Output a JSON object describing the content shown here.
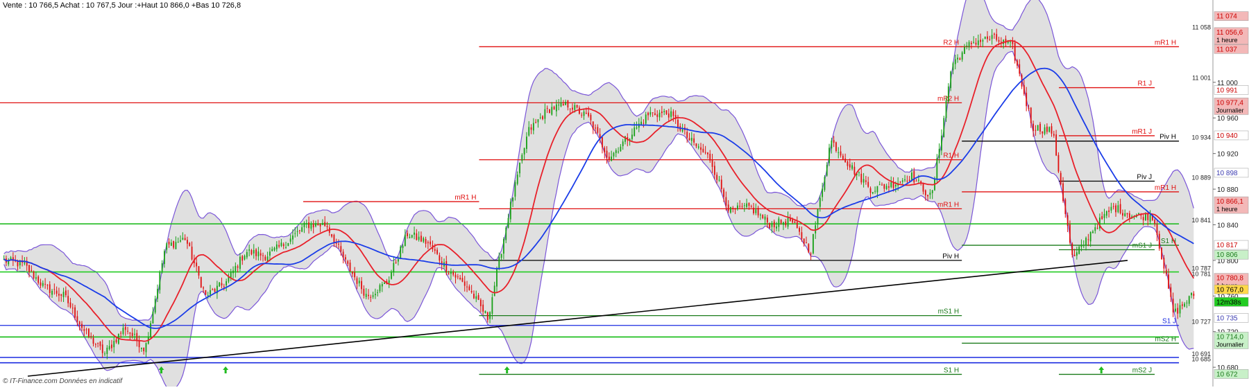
{
  "header": {
    "quote": "Vente : 10 766,5 Achat : 10 767,5 Jour :+Haut 10 866,0 +Bas 10 726,8"
  },
  "footer": {
    "credit": "© IT-Finance.com  Données en indicatif"
  },
  "chart_data": {
    "type": "candlestick",
    "y_range": [
      10670,
      11080
    ],
    "y_ticks": [
      "11 000",
      "10 960",
      "10 920",
      "10 880",
      "10 840",
      "10 800",
      "10 760",
      "10 720",
      "10 680"
    ],
    "grid": false,
    "bollinger_band": "on",
    "moving_averages": [
      "red",
      "blue"
    ],
    "trendline": {
      "from": 10670,
      "to": 10800
    },
    "close_anchors": [
      10800,
      10795,
      10770,
      10760,
      10720,
      10695,
      10725,
      10700,
      10815,
      10825,
      10760,
      10775,
      10810,
      10805,
      10820,
      10840,
      10840,
      10795,
      10760,
      10775,
      10830,
      10820,
      10790,
      10770,
      10735,
      10850,
      10945,
      10970,
      10975,
      10960,
      10915,
      10940,
      10965,
      10965,
      10935,
      10915,
      10855,
      10860,
      10840,
      10845,
      10810,
      10935,
      10905,
      10880,
      10885,
      10895,
      10870,
      11020,
      11045,
      11050,
      11040,
      10950,
      10945,
      10800,
      10835,
      10860,
      10850,
      10850,
      10740,
      10762
    ],
    "colors": {
      "bull": "#18a018",
      "bear": "#e01010",
      "ma_fast": "#e8202a",
      "ma_slow": "#1a3ce8",
      "band_edge": "#7a55d8",
      "band_fill": "#d8d8d8"
    },
    "price_levels": [
      {
        "label": "R2 H",
        "value": 11040,
        "color": "#e01010",
        "x1": 0.395,
        "x2": 0.793
      },
      {
        "label": "mR1 H",
        "value": 11040,
        "color": "#e01010",
        "x1": 0.792,
        "x2": 0.972
      },
      {
        "label": "R1 J",
        "value": 10994,
        "color": "#e01010",
        "x1": 0.873,
        "x2": 0.952
      },
      {
        "label": "mR2 H",
        "value": 10977,
        "color": "#e01010",
        "x1": 0.0,
        "x2": 0.793
      },
      {
        "label": "mR1 J",
        "value": 10940,
        "color": "#e01010",
        "x1": 0.873,
        "x2": 0.952
      },
      {
        "label": "Piv H",
        "value": 10934,
        "color": "#000000",
        "x1": 0.793,
        "x2": 0.972
      },
      {
        "label": "R1 H",
        "value": 10913,
        "color": "#e01010",
        "x1": 0.395,
        "x2": 0.793
      },
      {
        "label": "Piv J",
        "value": 10889,
        "color": "#000000",
        "x1": 0.873,
        "x2": 0.952
      },
      {
        "label": "mR1 H",
        "value": 10877,
        "color": "#e01010",
        "x1": 0.793,
        "x2": 0.972
      },
      {
        "label": "mR1 H",
        "value": 10858,
        "color": "#e01010",
        "x1": 0.395,
        "x2": 0.793
      },
      {
        "label": "mR1 H",
        "value": 10866,
        "color": "#e01010",
        "x1": 0.25,
        "x2": 0.395
      },
      {
        "label": "",
        "value": 10841,
        "color": "#22bb22",
        "x1": 0.0,
        "x2": 0.972
      },
      {
        "label": "S1 H",
        "value": 10817,
        "color": "#1a7a1a",
        "x1": 0.793,
        "x2": 0.972
      },
      {
        "label": "mS1 J",
        "value": 10812,
        "color": "#1a7a1a",
        "x1": 0.873,
        "x2": 0.952
      },
      {
        "label": "Piv H",
        "value": 10800,
        "color": "#000000",
        "x1": 0.395,
        "x2": 0.793
      },
      {
        "label": "",
        "value": 10787,
        "color": "#22cc22",
        "x1": 0.0,
        "x2": 0.972
      },
      {
        "label": "mS1 H",
        "value": 10738,
        "color": "#1a7a1a",
        "x1": 0.395,
        "x2": 0.793
      },
      {
        "label": "S1 J",
        "value": 10727,
        "color": "#1a2ae0",
        "x1": 0.0,
        "x2": 0.972
      },
      {
        "label": "",
        "value": 10714,
        "color": "#10bb10",
        "x1": 0.0,
        "x2": 0.972
      },
      {
        "label": "mS2 H",
        "value": 10707,
        "color": "#1a7a1a",
        "x1": 0.793,
        "x2": 0.972
      },
      {
        "label": "",
        "value": 10691,
        "color": "#1a2ae0",
        "x1": 0.0,
        "x2": 0.972
      },
      {
        "label": "",
        "value": 10685,
        "color": "#1a2ae0",
        "x1": 0.0,
        "x2": 0.972
      },
      {
        "label": "S1 H",
        "value": 10672,
        "color": "#1a7a1a",
        "x1": 0.395,
        "x2": 0.793
      },
      {
        "label": "mS2 J",
        "value": 10672,
        "color": "#1a7a1a",
        "x1": 0.873,
        "x2": 0.952
      }
    ],
    "axis_level_labels": [
      {
        "text": "11 058",
        "value": 11058
      },
      {
        "text": "11 001",
        "value": 11001
      },
      {
        "text": "10 934",
        "value": 10934
      },
      {
        "text": "10 889",
        "value": 10889
      },
      {
        "text": "10 841",
        "value": 10841
      },
      {
        "text": "10 787",
        "value": 10787
      },
      {
        "text": "10 781",
        "value": 10781
      },
      {
        "text": "10 727",
        "value": 10727
      },
      {
        "text": "10 691",
        "value": 10691
      },
      {
        "text": "10 685",
        "value": 10685
      }
    ],
    "axis_tags": [
      {
        "text": "11 074",
        "sub": "",
        "value": 11074,
        "bg": "#f3b8b8",
        "fg": "#cc0000"
      },
      {
        "text": "11 056,6",
        "sub": "1 heure",
        "value": 11056,
        "bg": "#f3b8b8",
        "fg": "#cc0000"
      },
      {
        "text": "11 037",
        "sub": "",
        "value": 11037,
        "bg": "#f3b8b8",
        "fg": "#cc0000"
      },
      {
        "text": "10 991",
        "sub": "",
        "value": 10991,
        "bg": "#ffffff",
        "fg": "#cc0000"
      },
      {
        "text": "10 977,4",
        "sub": "Journalier",
        "value": 10977,
        "bg": "#f3b8b8",
        "fg": "#cc0000"
      },
      {
        "text": "10 940",
        "sub": "",
        "value": 10940,
        "bg": "#ffffff",
        "fg": "#cc0000"
      },
      {
        "text": "10 898",
        "sub": "",
        "value": 10898,
        "bg": "#ffffff",
        "fg": "#3a3ab0"
      },
      {
        "text": "10 866,1",
        "sub": "1 heure",
        "value": 10866,
        "bg": "#f3b8b8",
        "fg": "#cc0000"
      },
      {
        "text": "10 817",
        "sub": "",
        "value": 10817,
        "bg": "#ffffff",
        "fg": "#cc0000"
      },
      {
        "text": "10 806",
        "sub": "",
        "value": 10806,
        "bg": "#c8f0c8",
        "fg": "#1a7a1a"
      },
      {
        "text": "10 780,8",
        "sub": "1 heure",
        "value": 10780,
        "bg": "#f3b8b8",
        "fg": "#cc0000"
      },
      {
        "text": "10 767,0",
        "sub": "",
        "value": 10767,
        "bg": "#ffd84a",
        "fg": "#000000"
      },
      {
        "text": "12m38s",
        "sub": "",
        "value": 10753,
        "bg": "#22cc22",
        "fg": "#000000"
      },
      {
        "text": "10 735",
        "sub": "",
        "value": 10735,
        "bg": "#ffffff",
        "fg": "#3a3ab0"
      },
      {
        "text": "10 714,0",
        "sub": "Journalier",
        "value": 10714,
        "bg": "#c8f0c8",
        "fg": "#1a7a1a"
      },
      {
        "text": "10 672",
        "sub": "",
        "value": 10672,
        "bg": "#c8f0c8",
        "fg": "#1a7a1a"
      }
    ],
    "arrow_markers": [
      0.133,
      0.186,
      0.418,
      0.908
    ]
  }
}
